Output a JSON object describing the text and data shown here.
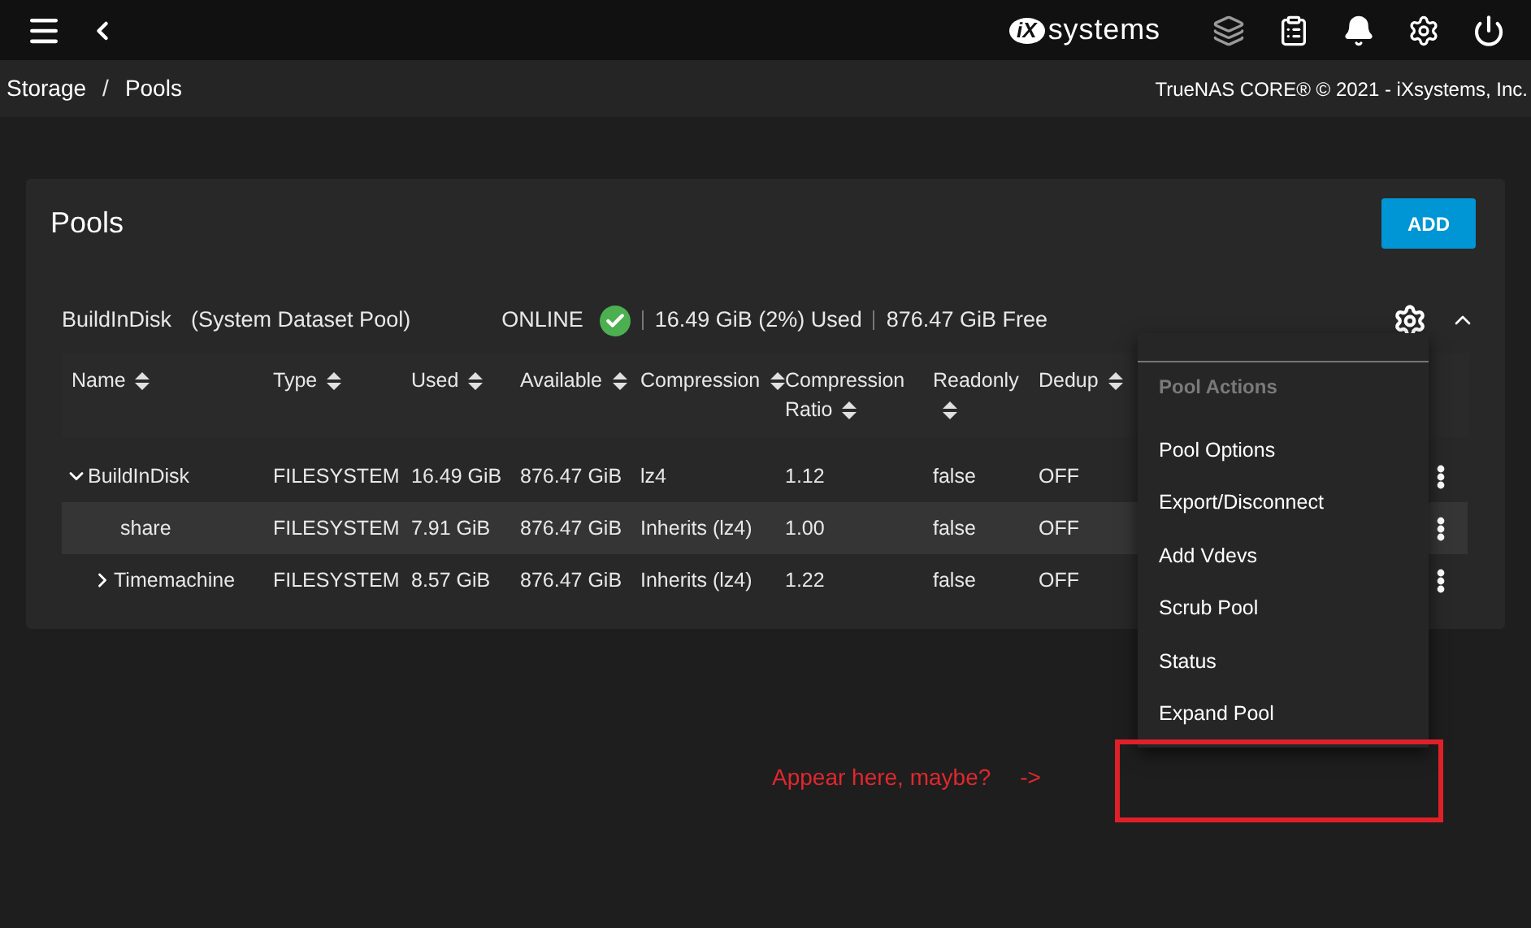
{
  "topbar": {
    "logo_mark": "iX",
    "logo_text": "systems"
  },
  "breadcrumb": {
    "items": [
      {
        "label": "Storage"
      },
      {
        "label": "Pools"
      }
    ],
    "separator": "/"
  },
  "copyright": "TrueNAS CORE® © 2021 - iXsystems, Inc.",
  "card": {
    "title": "Pools",
    "add_button": "ADD"
  },
  "pool": {
    "name": "BuildInDisk",
    "description": "(System Dataset Pool)",
    "status": "ONLINE",
    "healthy": true,
    "used": "16.49 GiB (2%) Used",
    "free": "876.47 GiB Free",
    "expanded": true
  },
  "table": {
    "columns": [
      {
        "label": "Name"
      },
      {
        "label": "Type"
      },
      {
        "label": "Used"
      },
      {
        "label": "Available"
      },
      {
        "label": "Compression"
      },
      {
        "label": "Compression Ratio"
      },
      {
        "label": "Readonly"
      },
      {
        "label": "Dedup"
      }
    ],
    "rows": [
      {
        "name": "BuildInDisk",
        "type": "FILESYSTEM",
        "used": "16.49 GiB",
        "available": "876.47 GiB",
        "compression": "lz4",
        "ratio": "1.12",
        "readonly": "false",
        "dedup": "OFF",
        "expanded": true,
        "selected": false,
        "children": [
          {
            "name": "share",
            "type": "FILESYSTEM",
            "used": "7.91 GiB",
            "available": "876.47 GiB",
            "compression": "Inherits (lz4)",
            "ratio": "1.00",
            "readonly": "false",
            "dedup": "OFF",
            "selected": true
          },
          {
            "name": "Timemachine",
            "type": "FILESYSTEM",
            "used": "8.57 GiB",
            "available": "876.47 GiB",
            "compression": "Inherits (lz4)",
            "ratio": "1.22",
            "readonly": "false",
            "dedup": "OFF",
            "expanded": false,
            "selected": false
          }
        ]
      }
    ]
  },
  "menu": {
    "heading": "Pool Actions",
    "items": [
      {
        "label": "Pool Options"
      },
      {
        "label": "Export/Disconnect"
      },
      {
        "label": "Add Vdevs"
      },
      {
        "label": "Scrub Pool"
      },
      {
        "label": "Status"
      },
      {
        "label": "Expand Pool"
      }
    ]
  },
  "annotation": {
    "text": "Appear here, maybe?",
    "arrow": "->"
  }
}
